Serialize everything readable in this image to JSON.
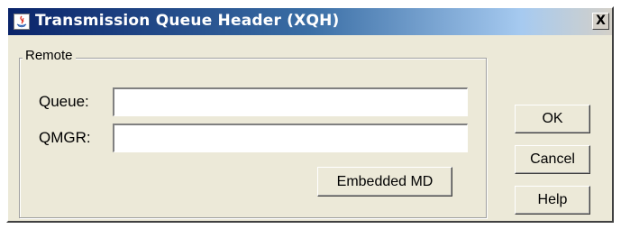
{
  "window": {
    "title": "Transmission Queue Header (XQH)",
    "close_glyph": "X",
    "app_icon": "java-icon"
  },
  "remote_group": {
    "legend": "Remote",
    "queue_label": "Queue:",
    "queue_value": "",
    "qmgr_label": "QMGR:",
    "qmgr_value": "",
    "embedded_md_label": "Embedded MD"
  },
  "buttons": {
    "ok_label": "OK",
    "cancel_label": "Cancel",
    "help_label": "Help"
  },
  "colors": {
    "title_bar_start": "#0a246a",
    "title_bar_end": "#d4d0c8",
    "dialog_face": "#ece9d8"
  }
}
